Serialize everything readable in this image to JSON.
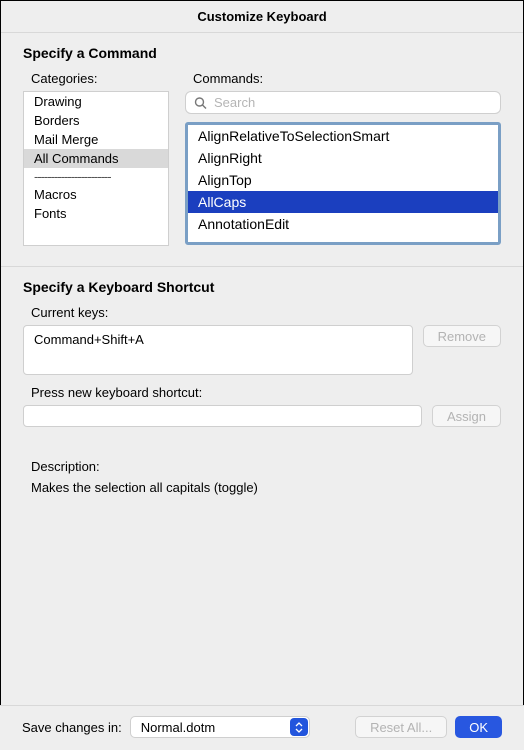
{
  "title": "Customize Keyboard",
  "section1": {
    "heading": "Specify a Command",
    "categories_label": "Categories:",
    "commands_label": "Commands:",
    "search_placeholder": "Search",
    "categories": {
      "items": [
        {
          "label": "Drawing",
          "selected": false
        },
        {
          "label": "Borders",
          "selected": false
        },
        {
          "label": "Mail Merge",
          "selected": false
        },
        {
          "label": "All Commands",
          "selected": true
        }
      ],
      "divider": "-----------------------",
      "items2": [
        {
          "label": "Macros",
          "selected": false
        },
        {
          "label": "Fonts",
          "selected": false
        }
      ]
    },
    "commands": [
      {
        "label": "AlignRelativeToSelectionSmart",
        "selected": false
      },
      {
        "label": "AlignRight",
        "selected": false
      },
      {
        "label": "AlignTop",
        "selected": false
      },
      {
        "label": "AllCaps",
        "selected": true
      },
      {
        "label": "AnnotationEdit",
        "selected": false
      }
    ]
  },
  "section2": {
    "heading": "Specify a Keyboard Shortcut",
    "current_keys_label": "Current keys:",
    "current_keys_value": "Command+Shift+A",
    "remove_label": "Remove",
    "press_new_label": "Press new keyboard shortcut:",
    "press_new_value": "",
    "assign_label": "Assign",
    "description_label": "Description:",
    "description_text": "Makes the selection all capitals (toggle)"
  },
  "footer": {
    "save_label": "Save changes in:",
    "save_value": "Normal.dotm",
    "reset_label": "Reset All...",
    "ok_label": "OK"
  }
}
